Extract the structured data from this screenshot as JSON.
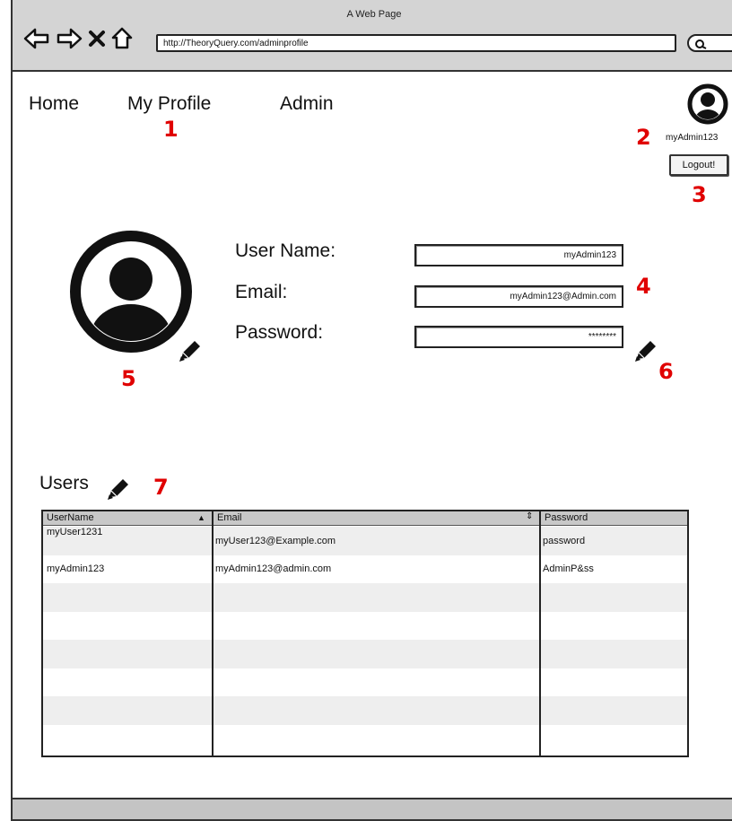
{
  "window": {
    "title": "A Web Page",
    "url": "http://TheoryQuery.com/adminprofile"
  },
  "nav": {
    "home": "Home",
    "my_profile": "My Profile",
    "admin": "Admin"
  },
  "current_user": {
    "username": "myAdmin123",
    "logout_label": "Logout!"
  },
  "profile": {
    "username_label": "User Name:",
    "username_value": "myAdmin123",
    "email_label": "Email:",
    "email_value": "myAdmin123@Admin.com",
    "password_label": "Password:",
    "password_value": "********"
  },
  "users": {
    "title": "Users",
    "columns": [
      "UserName",
      "Email",
      "Password"
    ],
    "rows": [
      {
        "username": "myUser1231",
        "email": "myUser123@Example.com",
        "password": "password"
      },
      {
        "username": "myAdmin123",
        "email": "myAdmin123@admin.com",
        "password": "AdminP&ss"
      }
    ]
  },
  "annotations": [
    "1",
    "2",
    "3",
    "4",
    "5",
    "6",
    "7"
  ],
  "colors": {
    "annotation": "#e00000",
    "chrome": "#d4d4d4",
    "row_alt": "#eeeeee",
    "header": "#c8c8c8"
  }
}
